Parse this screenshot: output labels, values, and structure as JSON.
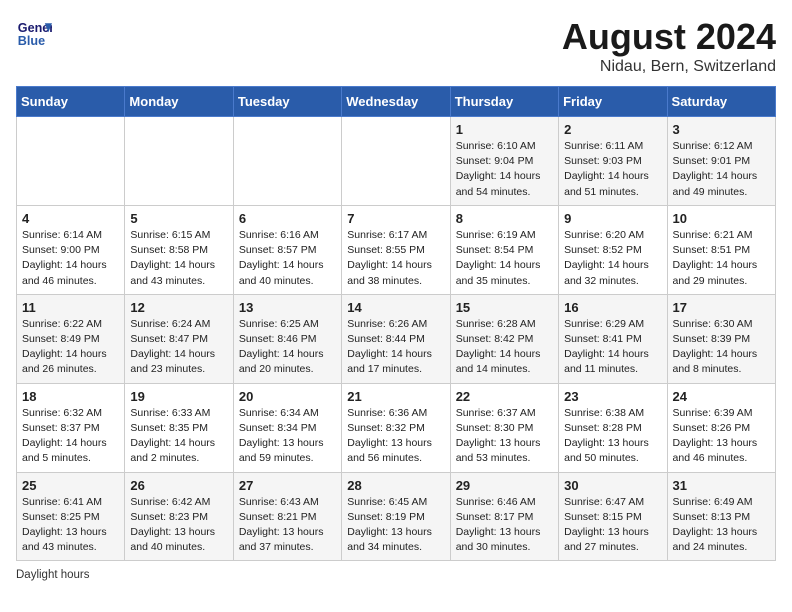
{
  "header": {
    "logo_line1": "General",
    "logo_line2": "Blue",
    "month": "August 2024",
    "location": "Nidau, Bern, Switzerland"
  },
  "days_of_week": [
    "Sunday",
    "Monday",
    "Tuesday",
    "Wednesday",
    "Thursday",
    "Friday",
    "Saturday"
  ],
  "weeks": [
    [
      {
        "day": "",
        "info": ""
      },
      {
        "day": "",
        "info": ""
      },
      {
        "day": "",
        "info": ""
      },
      {
        "day": "",
        "info": ""
      },
      {
        "day": "1",
        "info": "Sunrise: 6:10 AM\nSunset: 9:04 PM\nDaylight: 14 hours\nand 54 minutes."
      },
      {
        "day": "2",
        "info": "Sunrise: 6:11 AM\nSunset: 9:03 PM\nDaylight: 14 hours\nand 51 minutes."
      },
      {
        "day": "3",
        "info": "Sunrise: 6:12 AM\nSunset: 9:01 PM\nDaylight: 14 hours\nand 49 minutes."
      }
    ],
    [
      {
        "day": "4",
        "info": "Sunrise: 6:14 AM\nSunset: 9:00 PM\nDaylight: 14 hours\nand 46 minutes."
      },
      {
        "day": "5",
        "info": "Sunrise: 6:15 AM\nSunset: 8:58 PM\nDaylight: 14 hours\nand 43 minutes."
      },
      {
        "day": "6",
        "info": "Sunrise: 6:16 AM\nSunset: 8:57 PM\nDaylight: 14 hours\nand 40 minutes."
      },
      {
        "day": "7",
        "info": "Sunrise: 6:17 AM\nSunset: 8:55 PM\nDaylight: 14 hours\nand 38 minutes."
      },
      {
        "day": "8",
        "info": "Sunrise: 6:19 AM\nSunset: 8:54 PM\nDaylight: 14 hours\nand 35 minutes."
      },
      {
        "day": "9",
        "info": "Sunrise: 6:20 AM\nSunset: 8:52 PM\nDaylight: 14 hours\nand 32 minutes."
      },
      {
        "day": "10",
        "info": "Sunrise: 6:21 AM\nSunset: 8:51 PM\nDaylight: 14 hours\nand 29 minutes."
      }
    ],
    [
      {
        "day": "11",
        "info": "Sunrise: 6:22 AM\nSunset: 8:49 PM\nDaylight: 14 hours\nand 26 minutes."
      },
      {
        "day": "12",
        "info": "Sunrise: 6:24 AM\nSunset: 8:47 PM\nDaylight: 14 hours\nand 23 minutes."
      },
      {
        "day": "13",
        "info": "Sunrise: 6:25 AM\nSunset: 8:46 PM\nDaylight: 14 hours\nand 20 minutes."
      },
      {
        "day": "14",
        "info": "Sunrise: 6:26 AM\nSunset: 8:44 PM\nDaylight: 14 hours\nand 17 minutes."
      },
      {
        "day": "15",
        "info": "Sunrise: 6:28 AM\nSunset: 8:42 PM\nDaylight: 14 hours\nand 14 minutes."
      },
      {
        "day": "16",
        "info": "Sunrise: 6:29 AM\nSunset: 8:41 PM\nDaylight: 14 hours\nand 11 minutes."
      },
      {
        "day": "17",
        "info": "Sunrise: 6:30 AM\nSunset: 8:39 PM\nDaylight: 14 hours\nand 8 minutes."
      }
    ],
    [
      {
        "day": "18",
        "info": "Sunrise: 6:32 AM\nSunset: 8:37 PM\nDaylight: 14 hours\nand 5 minutes."
      },
      {
        "day": "19",
        "info": "Sunrise: 6:33 AM\nSunset: 8:35 PM\nDaylight: 14 hours\nand 2 minutes."
      },
      {
        "day": "20",
        "info": "Sunrise: 6:34 AM\nSunset: 8:34 PM\nDaylight: 13 hours\nand 59 minutes."
      },
      {
        "day": "21",
        "info": "Sunrise: 6:36 AM\nSunset: 8:32 PM\nDaylight: 13 hours\nand 56 minutes."
      },
      {
        "day": "22",
        "info": "Sunrise: 6:37 AM\nSunset: 8:30 PM\nDaylight: 13 hours\nand 53 minutes."
      },
      {
        "day": "23",
        "info": "Sunrise: 6:38 AM\nSunset: 8:28 PM\nDaylight: 13 hours\nand 50 minutes."
      },
      {
        "day": "24",
        "info": "Sunrise: 6:39 AM\nSunset: 8:26 PM\nDaylight: 13 hours\nand 46 minutes."
      }
    ],
    [
      {
        "day": "25",
        "info": "Sunrise: 6:41 AM\nSunset: 8:25 PM\nDaylight: 13 hours\nand 43 minutes."
      },
      {
        "day": "26",
        "info": "Sunrise: 6:42 AM\nSunset: 8:23 PM\nDaylight: 13 hours\nand 40 minutes."
      },
      {
        "day": "27",
        "info": "Sunrise: 6:43 AM\nSunset: 8:21 PM\nDaylight: 13 hours\nand 37 minutes."
      },
      {
        "day": "28",
        "info": "Sunrise: 6:45 AM\nSunset: 8:19 PM\nDaylight: 13 hours\nand 34 minutes."
      },
      {
        "day": "29",
        "info": "Sunrise: 6:46 AM\nSunset: 8:17 PM\nDaylight: 13 hours\nand 30 minutes."
      },
      {
        "day": "30",
        "info": "Sunrise: 6:47 AM\nSunset: 8:15 PM\nDaylight: 13 hours\nand 27 minutes."
      },
      {
        "day": "31",
        "info": "Sunrise: 6:49 AM\nSunset: 8:13 PM\nDaylight: 13 hours\nand 24 minutes."
      }
    ]
  ],
  "footer": "Daylight hours"
}
